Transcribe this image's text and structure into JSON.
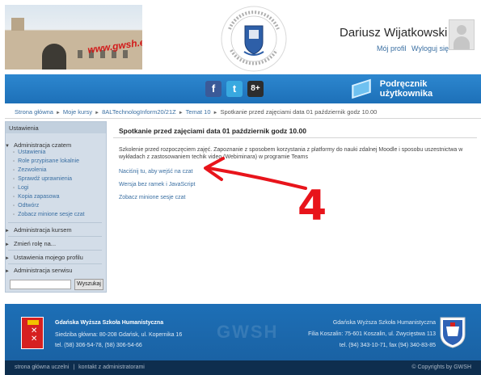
{
  "header": {
    "banner_text": "www.gwsh.edu.pl",
    "user_name": "Dariusz Wijatkowski",
    "profile_link": "Mój profil",
    "logout_link": "Wyloguj się",
    "social": {
      "facebook": "f",
      "twitter": "t",
      "google": "8+"
    },
    "manual_label": "Podręcznik użytkownika"
  },
  "breadcrumb": [
    "Strona główna",
    "Moje kursy",
    "8ALTechnologInform20/21Z",
    "Temat 10",
    "Spotkanie przed zajęciami data 01 październik godz 10.00"
  ],
  "sidebar": {
    "title": "Ustawienia",
    "course_admin": {
      "label": "Administracja czatem",
      "items": [
        "Ustawienia",
        "Role przypisane lokalnie",
        "Zezwolenia",
        "Sprawdź uprawnienia",
        "Logi",
        "Kopia zapasowa",
        "Odtwórz",
        "Zobacz minione sesje czat"
      ]
    },
    "sections": [
      "Administracja kursem",
      "Zmień rolę na...",
      "Ustawienia mojego profilu",
      "Administracja serwisu"
    ],
    "search_button": "Wyszukaj"
  },
  "main": {
    "title": "Spotkanie przed zajęciami data 01 październik godz 10.00",
    "description": "Szkolenie przed rozpoczęciem zajęć. Zapoznanie z sposobem korzystania z platformy do nauki zdalnej Moodle i sposobu uszestnictwa w wykładach z zastosowaniem techik video (Webiminara) w programie Teams",
    "links": [
      "Naciśnij tu, aby wejść na czat",
      "Wersja bez ramek i JavaScript",
      "Zobacz minione sesje czat"
    ]
  },
  "annotation": {
    "number": "4",
    "color": "#e8141b"
  },
  "footer": {
    "left_title": "Gdańska Wyższa Szkoła Humanistyczna",
    "left_address": "Siedziba główna: 80-208 Gdańsk, ul. Kopernika 16",
    "left_phone": "tel. (58) 306-54-78, (58) 306-54-66",
    "watermark": "GWSH",
    "right_title": "Gdańska Wyższa Szkoła Humanistyczna",
    "right_address": "Filia Koszalin: 75-601 Koszalin, ul. Zwycięstwa 113",
    "right_phone": "tel. (94) 343-10-71, fax (94) 340-83-85",
    "bottom_home": "strona główna uczelni",
    "bottom_contact": "kontakt z administratorami",
    "copyright": "© Copyrights by GWSH"
  },
  "colors": {
    "blue_bar": "#1d70b8",
    "link": "#3a6fa2",
    "footer": "#1a62a4",
    "bottom_bar": "#0e2e4e"
  }
}
